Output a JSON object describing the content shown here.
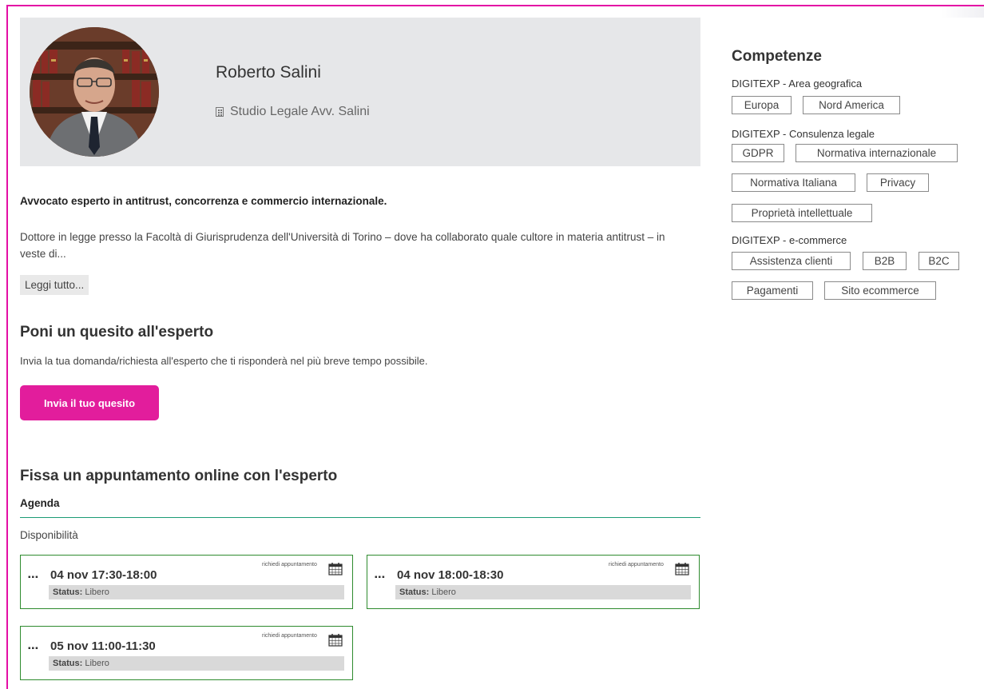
{
  "profile": {
    "name": "Roberto Salini",
    "organization": "Studio Legale Avv. Salini",
    "organization_icon": "building-icon"
  },
  "bio": {
    "headline": "Avvocato esperto in antitrust, concorrenza e commercio internazionale.",
    "text": "Dottore in legge presso la Facoltà di Giurisprudenza dell'Università di Torino – dove ha collaborato quale cultore in materia antitrust – in veste di...",
    "read_more": "Leggi tutto..."
  },
  "ask": {
    "title": "Poni un quesito all'esperto",
    "description": "Invia la tua domanda/richiesta all'esperto che ti risponderà nel più breve tempo possibile.",
    "button": "Invia il tuo quesito",
    "button_color": "#e21d9c"
  },
  "appointment": {
    "title": "Fissa un appuntamento online con l'esperto",
    "agenda_label": "Agenda",
    "availability_label": "Disponibilità",
    "slots": [
      {
        "dots": "▪▪▪",
        "time": "04 nov 17:30-18:00",
        "request": "richiedi appuntamento",
        "status_label": "Status:",
        "status": "Libero"
      },
      {
        "dots": "▪▪▪",
        "time": "04 nov 18:00-18:30",
        "request": "richiedi appuntamento",
        "status_label": "Status:",
        "status": "Libero"
      },
      {
        "dots": "▪▪▪",
        "time": "05 nov 11:00-11:30",
        "request": "richiedi appuntamento",
        "status_label": "Status:",
        "status": "Libero"
      }
    ]
  },
  "skills": {
    "title": "Competenze",
    "groups": [
      {
        "label": "DIGITEXP - Area geografica",
        "tags": [
          "Europa",
          "Nord America"
        ]
      },
      {
        "label": "DIGITEXP - Consulenza legale",
        "tags": [
          "GDPR",
          "Normativa internazionale",
          "Normativa Italiana",
          "Privacy",
          "Proprietà intellettuale"
        ]
      },
      {
        "label": "DIGITEXP - e-commerce",
        "tags": [
          "Assistenza clienti",
          "B2B",
          "B2C",
          "Pagamenti",
          "Sito ecommerce"
        ]
      }
    ]
  },
  "colors": {
    "accent": "#e40ea5",
    "slot_border": "#2e8b2e",
    "agenda_rule": "#1a9b75"
  }
}
